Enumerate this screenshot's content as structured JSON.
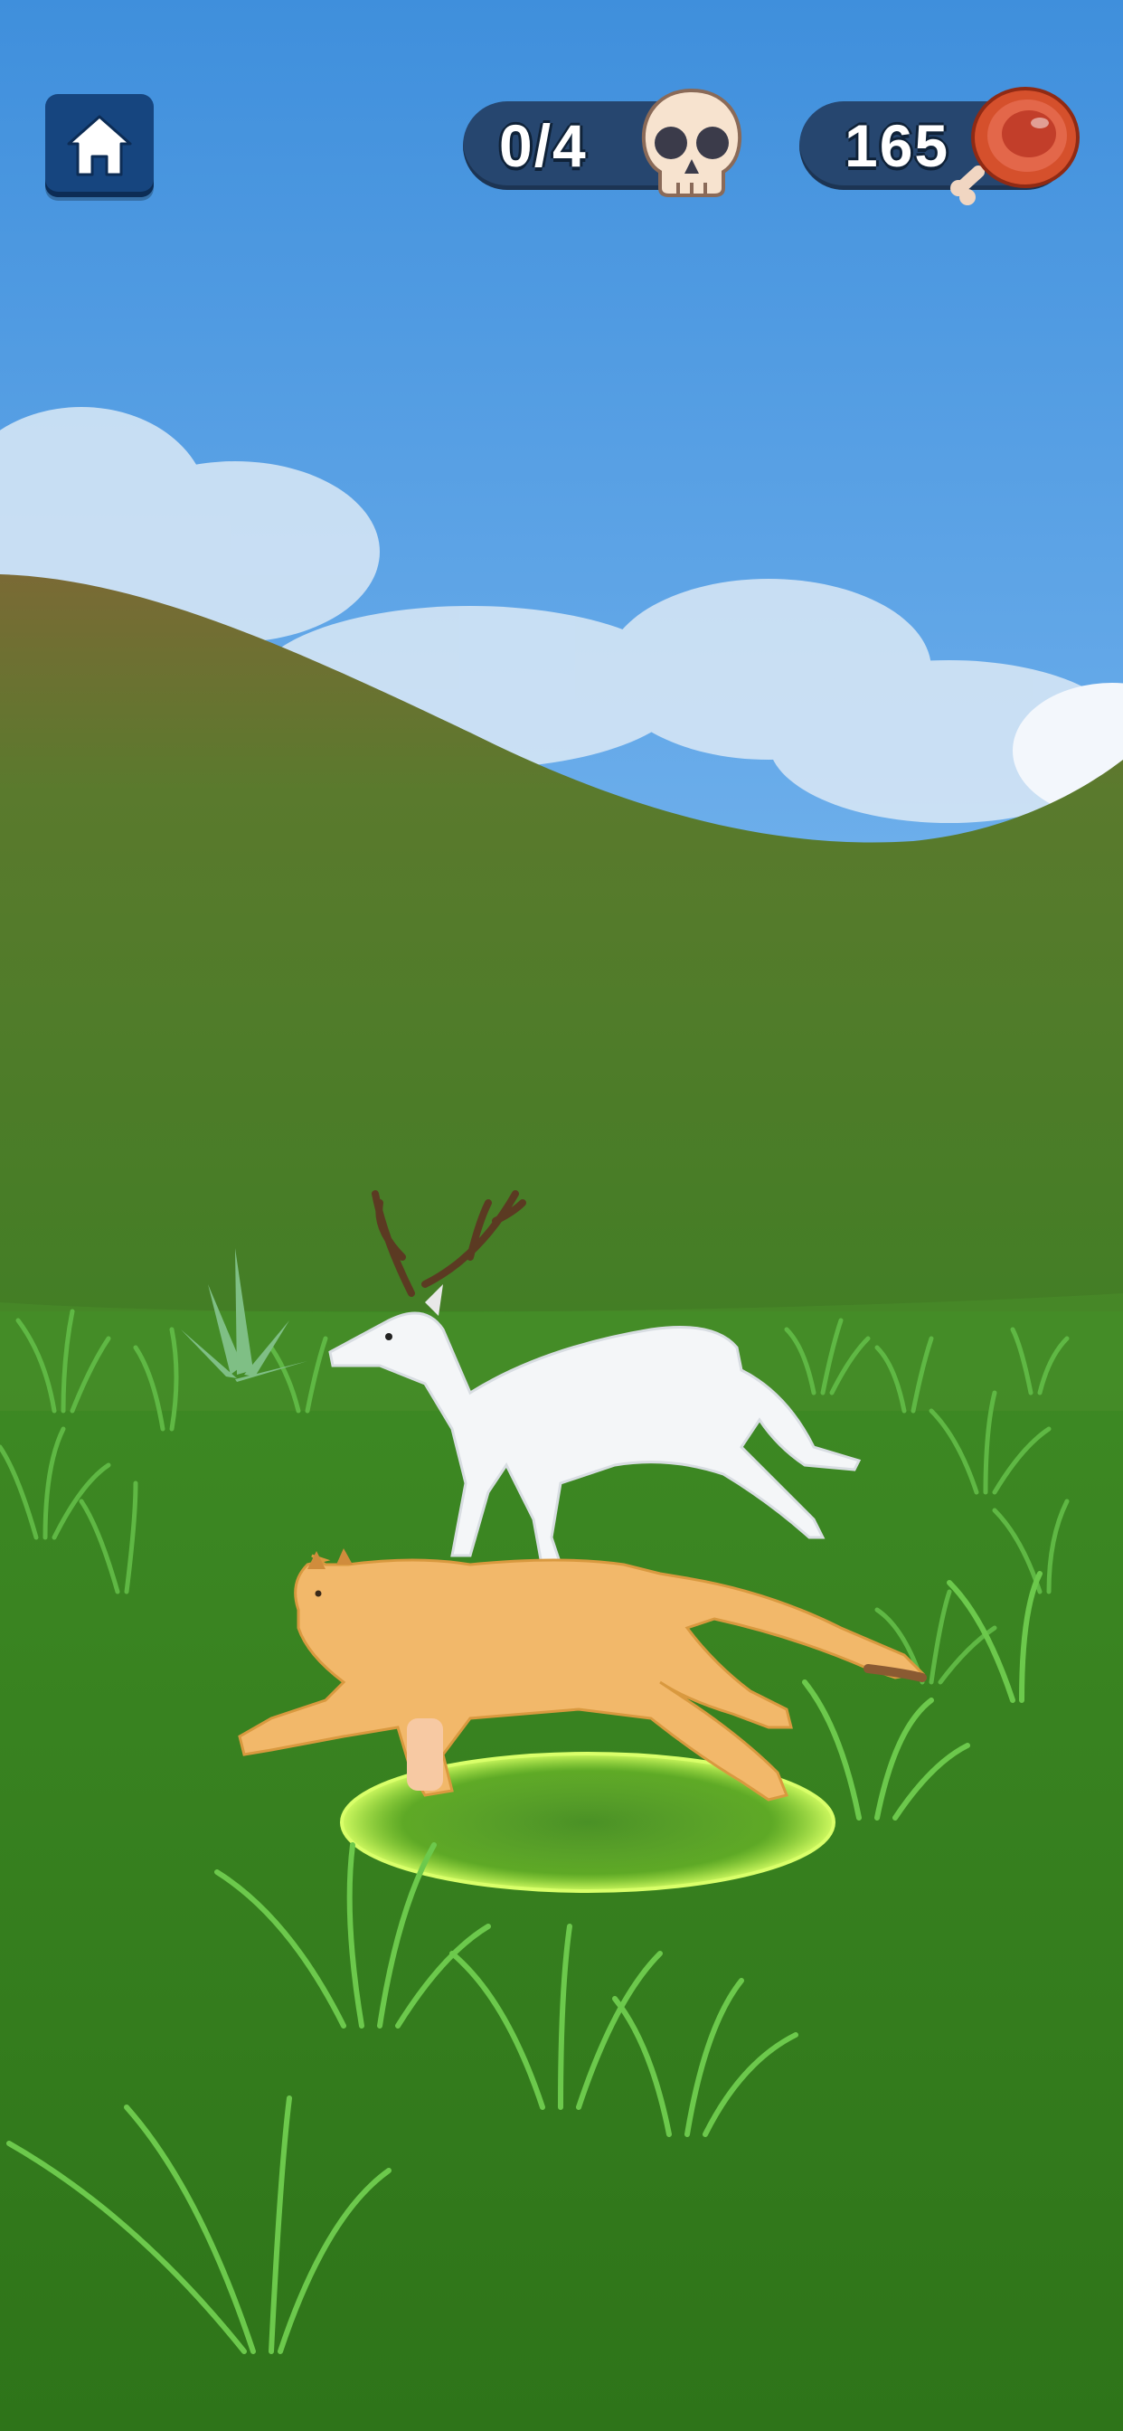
{
  "hud": {
    "home_icon": "house-icon",
    "kills": {
      "text": "0/4",
      "icon": "skull-icon"
    },
    "meat": {
      "text": "165",
      "icon": "meat-icon"
    }
  },
  "scene": {
    "sky_color": "#4a97df",
    "grass_color": "#3f8a26",
    "player": "cougar",
    "prey": "white-deer",
    "target_ring_color": "#9be23b"
  }
}
